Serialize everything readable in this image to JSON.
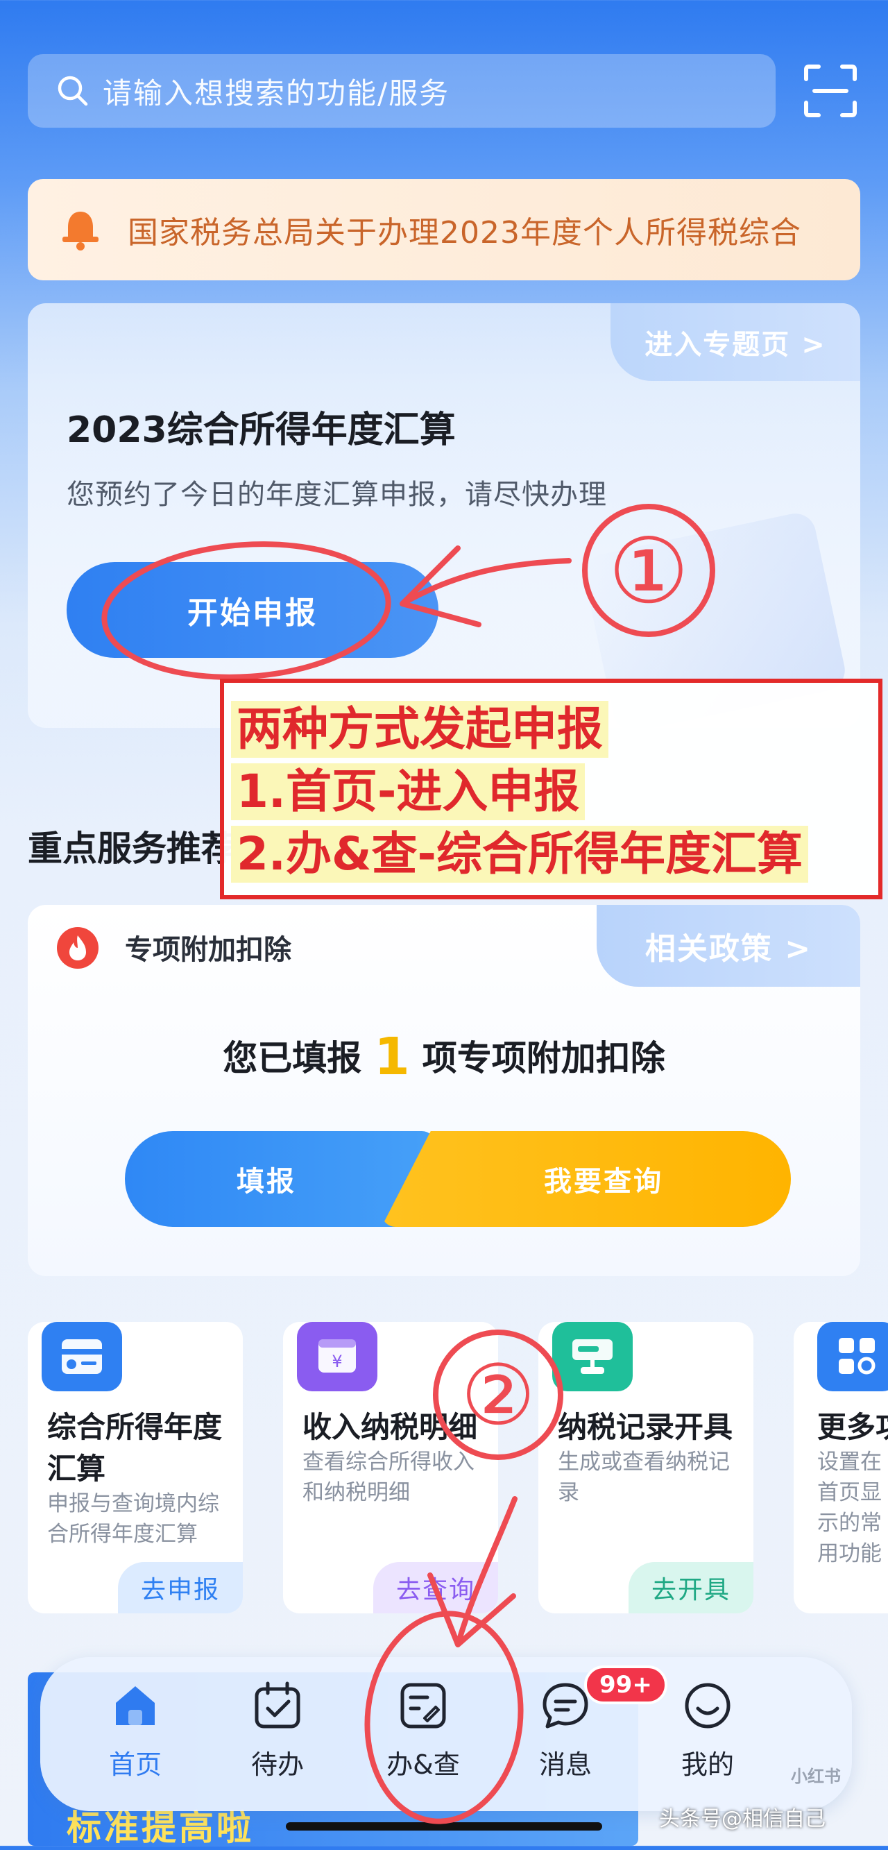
{
  "search": {
    "placeholder": "请输入想搜索的功能/服务",
    "icon": "search-icon"
  },
  "scan": {
    "icon": "scan-icon"
  },
  "notice": {
    "icon": "bell-icon",
    "text": "国家税务总局关于办理2023年度个人所得税综合"
  },
  "annual": {
    "topic_link": "进入专题页 >",
    "title": "2023综合所得年度汇算",
    "subtitle": "您预约了今日的年度汇算申报，请尽快办理",
    "start_button": "开始申报"
  },
  "annotation": {
    "mark1": "①",
    "mark2": "②",
    "box_lines": [
      "两种方式发起申报",
      "1.首页-进入申报",
      "2.办&查-综合所得年度汇算"
    ]
  },
  "section": {
    "title": "重点服务推荐"
  },
  "deduction": {
    "icon": "fire-icon",
    "name": "专项附加扣除",
    "policy_link": "相关政策 >",
    "line_prefix": "您已填报",
    "count": "1",
    "line_suffix": "项专项附加扣除",
    "fill_button": "填报",
    "query_button": "我要查询"
  },
  "services": [
    {
      "icon": "annual-settle-icon",
      "name": "综合所得年度汇算",
      "desc": "申报与查询境内综合所得年度汇算",
      "action": "去申报",
      "color": "#2f80f2"
    },
    {
      "icon": "income-detail-icon",
      "name": "收入纳税明细",
      "desc": "查看综合所得收入和纳税明细",
      "action": "去查询",
      "color": "#8a5cf0"
    },
    {
      "icon": "tax-record-icon",
      "name": "纳税记录开具",
      "desc": "生成或查看纳税记录",
      "action": "去开具",
      "color": "#1fbf9a"
    },
    {
      "icon": "more-services-icon",
      "name": "更多功能",
      "desc": "设置在首页显示的常用功能",
      "action": "",
      "color": "#2f80f2"
    }
  ],
  "nav": {
    "items": [
      {
        "icon": "home-icon",
        "label": "首页"
      },
      {
        "icon": "calendar-check-icon",
        "label": "待办"
      },
      {
        "icon": "handle-query-icon",
        "label": "办&查"
      },
      {
        "icon": "message-icon",
        "label": "消息"
      },
      {
        "icon": "smiley-icon",
        "label": "我的"
      }
    ],
    "badge": "99+"
  },
  "promo": {
    "text": "标准提高啦"
  },
  "watermarks": {
    "xhs": "小红书",
    "toutiao": "头条号@相信自己"
  },
  "colors": {
    "accent": "#2f7bf0",
    "warning": "#ffb400",
    "annotation": "#e0282c",
    "badge": "#f2354a"
  }
}
